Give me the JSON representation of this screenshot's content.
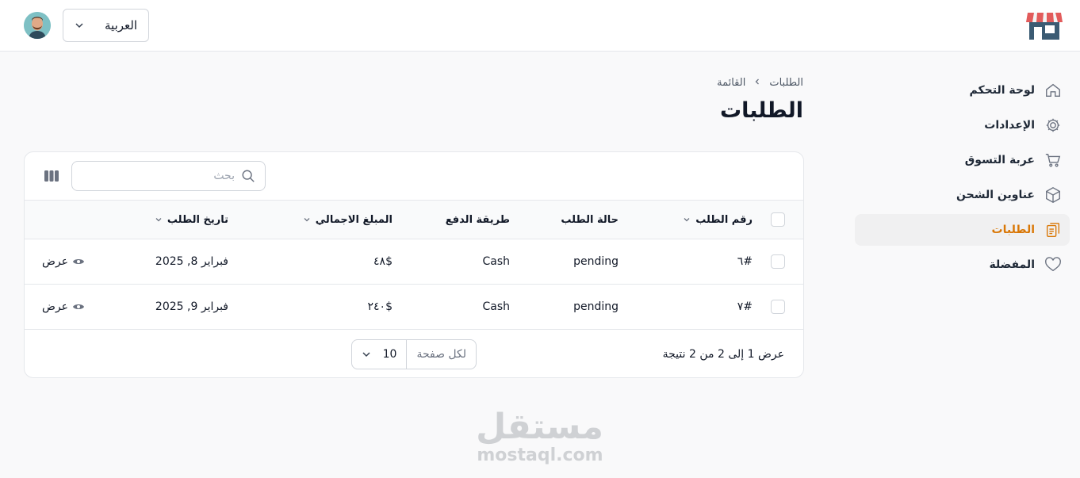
{
  "header": {
    "language": "العربية"
  },
  "sidebar": {
    "items": [
      {
        "label": "لوحة التحكم",
        "icon": "home-icon"
      },
      {
        "label": "الإعدادات",
        "icon": "gear-icon"
      },
      {
        "label": "عربة التسوق",
        "icon": "cart-icon"
      },
      {
        "label": "عناوين الشحن",
        "icon": "box-icon"
      },
      {
        "label": "الطلبات",
        "icon": "clipboard-icon",
        "active": true
      },
      {
        "label": "المفضلة",
        "icon": "heart-icon"
      }
    ]
  },
  "breadcrumb": {
    "root": "الطلبات",
    "current": "القائمة"
  },
  "page": {
    "title": "الطلبات"
  },
  "table": {
    "search_placeholder": "بحث",
    "columns": {
      "order_number": "رقم الطلب",
      "status": "حالة الطلب",
      "payment": "طريقة الدفع",
      "total": "المبلغ الاجمالي",
      "date": "تاريخ الطلب"
    },
    "rows": [
      {
        "order_number": "#٦",
        "status": "pending",
        "payment": "Cash",
        "total": "$٤٨",
        "date": "فبراير 8, 2025",
        "action": "عرض"
      },
      {
        "order_number": "#٧",
        "status": "pending",
        "payment": "Cash",
        "total": "$٢٤٠",
        "date": "فبراير 9, 2025",
        "action": "عرض"
      }
    ],
    "results_text": "عرض 1 إلى 2 من 2 نتيجة",
    "per_page_label": "لكل صفحة",
    "per_page_value": "10"
  },
  "watermark": {
    "arabic": "مستقل",
    "latin": "mostaql.com"
  },
  "colors": {
    "accent": "#d97706",
    "active_bg": "#f0f0f1"
  }
}
